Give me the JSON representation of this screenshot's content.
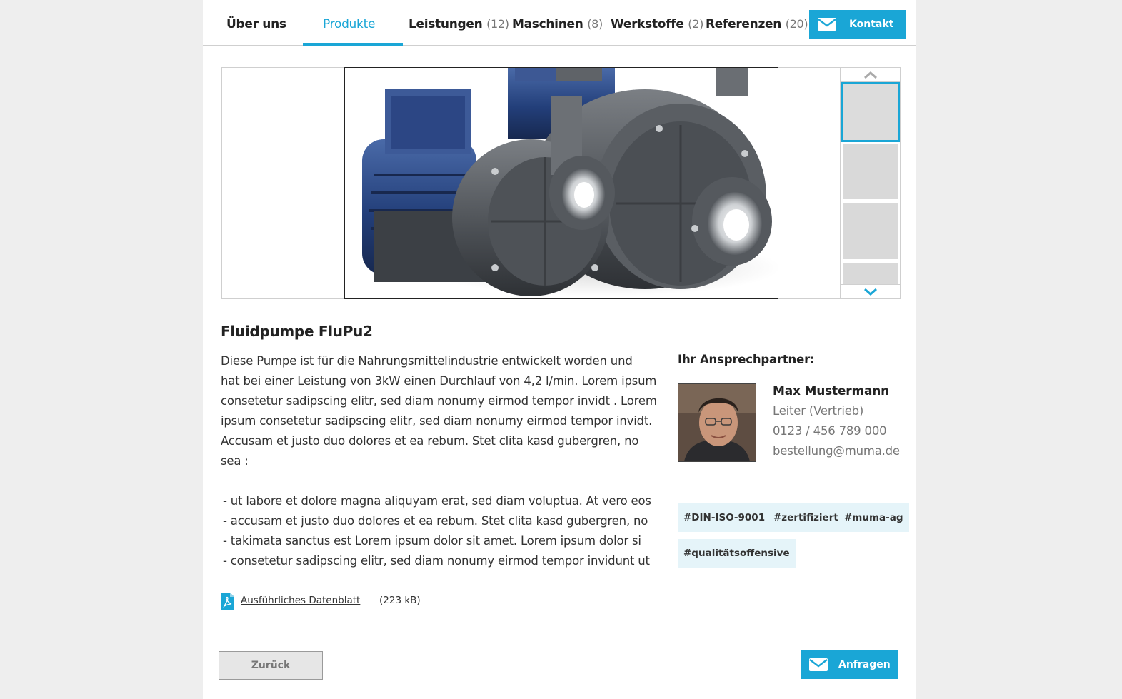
{
  "nav": {
    "items": [
      {
        "label": "Über uns",
        "count": ""
      },
      {
        "label": "Produkte",
        "count": ""
      },
      {
        "label": "Leistungen",
        "count": "(12)"
      },
      {
        "label": "Maschinen",
        "count": "(8)"
      },
      {
        "label": "Werkstoffe",
        "count": "(2)"
      },
      {
        "label": "Referenzen",
        "count": "(20)"
      }
    ],
    "active_index": 1,
    "contact_button": "Kontakt"
  },
  "gallery": {
    "main_image_icon": "pump-photo",
    "thumbnail_count": 4,
    "selected_thumbnail": 0,
    "up_icon": "chevron-up-icon",
    "down_icon": "chevron-down-icon"
  },
  "product": {
    "title": "Fluidpumpe FluPu2",
    "description_lines": [
      "Diese Pumpe ist für die Nahrungsmittelindustrie entwickelt worden  und",
      "hat bei einer Leistung von 3kW einen Durchlauf von 4,2 l/min.  Lorem ipsum",
      "consetetur sadipscing elitr, sed diam nonumy eirmod tempor invidt .  Lorem",
      "ipsum consetetur sadipscing elitr, sed diam nonumy eirmod tempor invidt.",
      "Accusam et justo duo dolores et ea rebum. Stet clita kasd gubergren, no",
      "sea :"
    ],
    "bullets": [
      "- ut labore et dolore magna aliquyam erat,  sed diam voluptua. At vero eos",
      "- accusam et justo duo dolores et ea rebum. Stet clita kasd gubergren, no",
      "- takimata sanctus est Lorem ipsum dolor sit amet. Lorem ipsum dolor si",
      "- consetetur sadipscing elitr, sed diam nonumy eirmod tempor invidunt ut"
    ],
    "datasheet_label": "Ausführliches Datenblatt",
    "datasheet_size": "(223 kB)"
  },
  "contact": {
    "heading": "Ihr Ansprechpartner:",
    "name": "Max Mustermann",
    "role": "Leiter (Vertrieb)",
    "phone": "0123 / 456 789 000",
    "email": "bestellung@muma.de"
  },
  "tags": [
    "#DIN-ISO-9001",
    "#zertifiziert",
    "#muma-ag",
    "#qualitätsoffensive"
  ],
  "actions": {
    "back": "Zurück",
    "inquire": "Anfragen"
  },
  "colors": {
    "accent": "#1aa6d6",
    "tag_background": "#e5f4f9",
    "page_background": "#eeeeee"
  }
}
